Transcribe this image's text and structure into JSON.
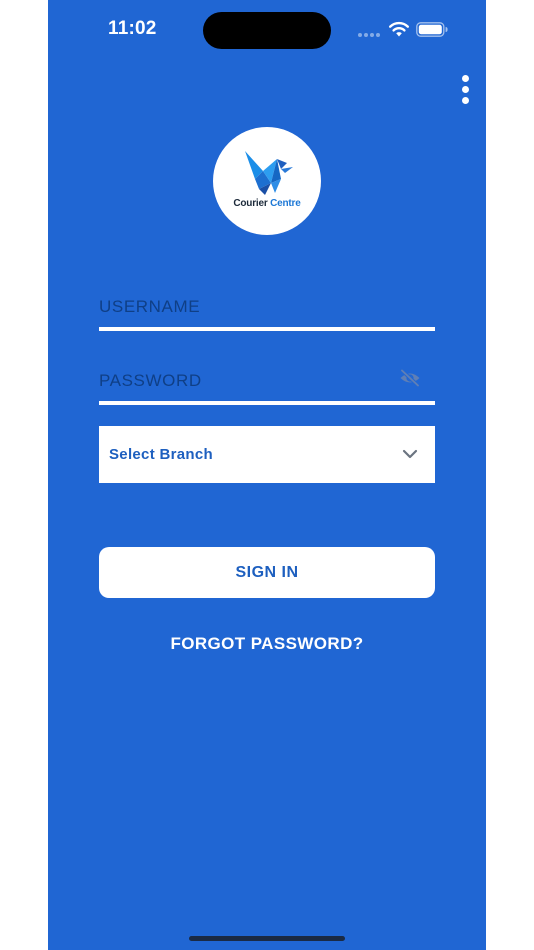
{
  "status_bar": {
    "time": "11:02"
  },
  "header": {
    "menu_icon": "more-vertical-icon"
  },
  "logo": {
    "brand_part1": "Courier",
    "brand_part2": "Centre",
    "colors": {
      "text_dark": "#1c2a3a",
      "text_accent": "#1d78d6"
    }
  },
  "login_form": {
    "username_placeholder": "USERNAME",
    "password_placeholder": "PASSWORD",
    "password_toggle_icon": "eye-off-icon",
    "branch_select": {
      "selected": "Select Branch",
      "icon": "chevron-down-icon"
    },
    "sign_in_label": "SIGN IN",
    "forgot_password_label": "FORGOT PASSWORD?"
  },
  "colors": {
    "background": "#2066d3",
    "placeholder": "#0f3f86",
    "primary_text": "#1d5fbf",
    "surface": "#ffffff"
  }
}
